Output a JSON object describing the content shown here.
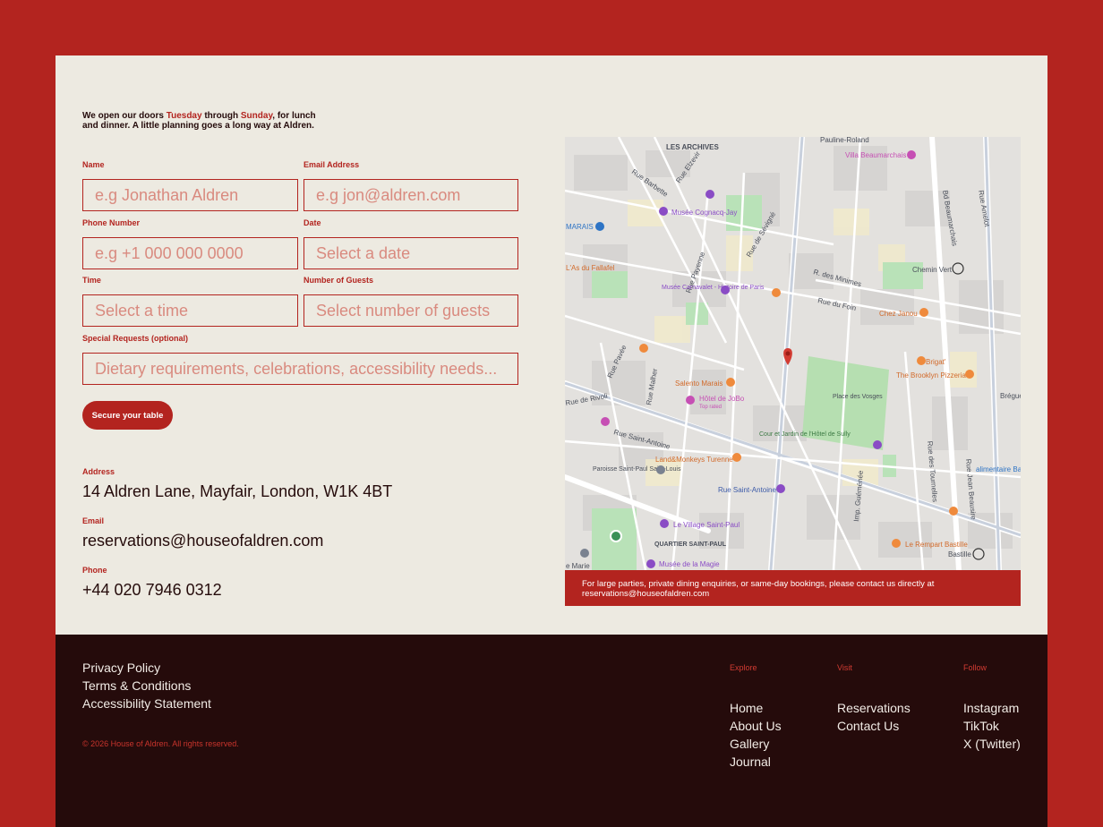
{
  "intro": {
    "part1": "We open our doors ",
    "day1": "Tuesday",
    "part2": " through ",
    "day2": "Sunday",
    "part3": ", for lunch and dinner. A little planning goes a long way at Aldren."
  },
  "form": {
    "name_label": "Name",
    "name_placeholder": "e.g Jonathan Aldren",
    "email_label": "Email Address",
    "email_placeholder": "e.g jon@aldren.com",
    "phone_label": "Phone Number",
    "phone_placeholder": "e.g +1 000 000 0000",
    "date_label": "Date",
    "date_placeholder": "Select a date",
    "time_label": "Time",
    "time_placeholder": "Select a time",
    "guests_label": "Number of Guests",
    "guests_placeholder": "Select number of guests",
    "requests_label": "Special Requests (optional)",
    "requests_placeholder": "Dietary requirements, celebrations, accessibility needs...",
    "submit_label": "Secure your table"
  },
  "contact": {
    "address_label": "Address",
    "address_value": "14 Aldren Lane, Mayfair, London, W1K 4BT",
    "email_label": "Email",
    "email_value": "reservations@houseofaldren.com",
    "phone_label": "Phone",
    "phone_value": "+44 020 7946 0312"
  },
  "map": {
    "labels": {
      "archives": "LES ARCHIVES",
      "pauline": "Pauline-Roland",
      "villa": "Villa Beaumarchais",
      "barbette": "Rue Barbette",
      "elzevir": "Rue Elzevir",
      "cognacq": "Musée Cognacq-Jay",
      "marais": "MARAIS",
      "sevigne": "Rue de Sévigné",
      "beaumarchais": "Bd Beaumarchais",
      "amelot": "Rue Amelot",
      "falafel": "L'As du Fallafel",
      "payenne": "Rue Payenne",
      "minimes": "R. des Minimes",
      "chemin": "Chemin Vert",
      "carnavalet": "Musée Carnavalet - Histoire de Paris",
      "foin": "Rue du Foin",
      "chez_janou": "Chez Janou",
      "brigat": "Brigat'",
      "brooklyn": "The Brooklyn Pizzeria",
      "pavee": "Rue Pavée",
      "malher": "Rue Malher",
      "salento": "Salento Marais",
      "jobo": "Hôtel de JoBo",
      "toprated": "Top rated",
      "vosges": "Place des Vosges",
      "tournelles": "Rue des Tournelles",
      "breguet": "Bréguet",
      "rivoli": "Rue de Rivoli",
      "st_antoine": "Rue Saint-Antoine",
      "sully": "Cour et Jardin de l'Hôtel de Sully",
      "landmonkeys": "Land&Monkeys Turenne",
      "st_paul": "Paroisse Saint-Paul Saint-Louis",
      "st_antoine2": "Rue Saint-Antoine",
      "jean_beausire": "Rue Jean Beausire",
      "alimentaire": "alimentaire Ba",
      "village": "Le Village Saint-Paul",
      "quartier": "QUARTIER SAINT-PAUL",
      "rempart": "Le Rempart Bastille",
      "bastille": "Bastille",
      "magie": "Musée de la Magie",
      "marie": "e Marie",
      "guemenee": "Imp. Guéménée"
    }
  },
  "notice": "For large parties, private dining enquiries, or same-day bookings, please contact us directly at reservations@houseofaldren.com",
  "footer": {
    "legal": [
      "Privacy Policy",
      "Terms & Conditions",
      "Accessibility Statement"
    ],
    "copyright": "© 2026 House of Aldren. All rights reserved.",
    "explore_heading": "Explore",
    "explore": [
      "Home",
      "About Us",
      "Gallery",
      "Journal"
    ],
    "visit_heading": "Visit",
    "visit": [
      "Reservations",
      "Contact Us"
    ],
    "follow_heading": "Follow",
    "follow": [
      "Instagram",
      "TikTok",
      "X (Twitter)"
    ]
  },
  "colors": {
    "brand_red": "#b3241f",
    "cream": "#edeae1",
    "dark": "#250b0b",
    "placeholder": "#d98a7f"
  }
}
